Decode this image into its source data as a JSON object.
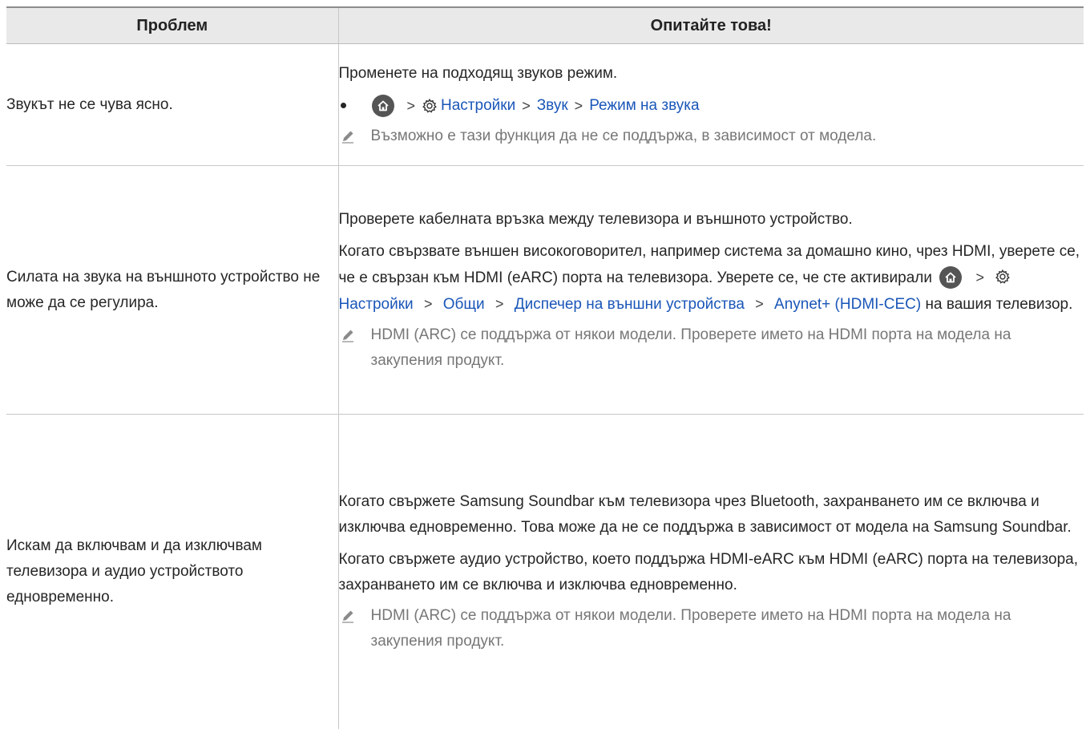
{
  "table": {
    "headers": [
      "Проблем",
      "Опитайте това!"
    ],
    "rows": [
      {
        "problem": "Звукът не се чува ясно.",
        "intro": "Променете на подходящ звуков режим.",
        "path": [
          "Настройки",
          "Звук",
          "Режим на звука"
        ],
        "note": "Възможно е тази функция да не се поддържа, в зависимост от модела."
      },
      {
        "problem": "Силата на звука на външното устройство не може да се регулира.",
        "p1": "Проверете кабелната връзка между телевизора и външното устройство.",
        "p2_text": "Когато свързвате външен високоговорител, например система за домашно кино, чрез HDMI, уверете се, че е свързан към HDMI (eARC) порта на телевизора. Уверете се, че сте активирали",
        "p2_links": [
          "Настройки",
          "Общи",
          "Диспечер на външни устройства",
          "Anynet+ (HDMI-CEC)"
        ],
        "p2_tail": "на вашия телевизор.",
        "note": "HDMI (ARC) се поддържа от някои модели. Проверете името на HDMI порта на модела на закупения продукт."
      },
      {
        "problem": "Искам да включвам и да изключвам телевизора и аудио устройството едновременно.",
        "p1": "Когато свържете Samsung Soundbar към телевизора чрез Bluetooth, захранването им се включва и изключва едновременно. Това може да не се поддържа в зависимост от модела на Samsung Soundbar.",
        "p2": "Когато свържете аудио устройство, което поддържа HDMI-eARC към HDMI (eARC) порта на телевизора, захранването им се включва и изключва едновременно.",
        "note": "HDMI (ARC) се поддържа от някои модели. Проверете името на HDMI порта на модела на закупения продукт."
      }
    ]
  },
  "icons": {
    "home": "home-icon",
    "settings": "gear-icon",
    "note": "pencil-icon",
    "chevron": "chevron-right-icon"
  },
  "colors": {
    "link": "#1a56b8",
    "header_bg": "#e9e9e9",
    "note_text": "#777777"
  }
}
